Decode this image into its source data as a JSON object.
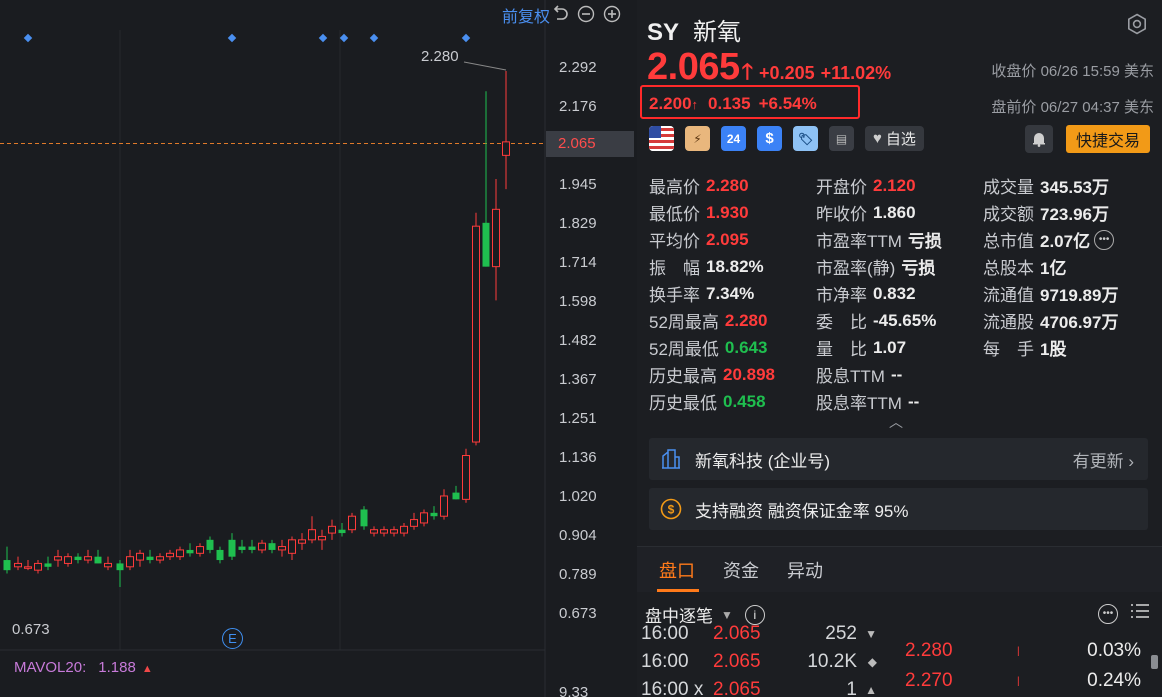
{
  "chart": {
    "toolbar_label": "前复权",
    "y_ticks": [
      "2.292",
      "2.176",
      "1.945",
      "1.829",
      "1.714",
      "1.598",
      "1.482",
      "1.367",
      "1.251",
      "1.136",
      "1.020",
      "0.904",
      "0.789",
      "0.673"
    ],
    "current_price_tag": "2.065",
    "high_label": "2.280",
    "low_label": "0.673",
    "bottom_tick": "9.33",
    "event_marker": "E",
    "mavol_label": "MAVOL20:",
    "mavol_value": "1.188",
    "colors": {
      "up": "#ff3b3b",
      "down": "#1fbf4f",
      "accent": "#4a8ff0"
    }
  },
  "quote": {
    "ticker": "SY",
    "name": "新氧",
    "price": "2.065",
    "change": "+0.205",
    "change_pct": "+11.02%",
    "close_meta": "收盘价 06/26 15:59 美东",
    "pre_price": "2.200",
    "pre_change": "0.135",
    "pre_change_pct": "+6.54%",
    "pre_meta": "盘前价 06/27 04:37 美东",
    "watch_label": "自选",
    "trade_label": "快捷交易",
    "badge_24": "24"
  },
  "stats": [
    [
      {
        "label": "最高价",
        "value": "2.280",
        "color": "red"
      },
      {
        "label": "开盘价",
        "value": "2.120",
        "color": "red"
      },
      {
        "label": "成交量",
        "value": "345.53万",
        "color": "white"
      }
    ],
    [
      {
        "label": "最低价",
        "value": "1.930",
        "color": "red"
      },
      {
        "label": "昨收价",
        "value": "1.860",
        "color": "white"
      },
      {
        "label": "成交额",
        "value": "723.96万",
        "color": "white"
      }
    ],
    [
      {
        "label": "平均价",
        "value": "2.095",
        "color": "red"
      },
      {
        "label": "市盈率TTM",
        "value": "亏损",
        "color": "white"
      },
      {
        "label": "总市值",
        "value": "2.07亿",
        "color": "white"
      }
    ],
    [
      {
        "label": "振　幅",
        "value": "18.82%",
        "color": "white"
      },
      {
        "label": "市盈率(静)",
        "value": "亏损",
        "color": "white"
      },
      {
        "label": "总股本",
        "value": "1亿",
        "color": "white"
      }
    ],
    [
      {
        "label": "换手率",
        "value": "7.34%",
        "color": "white"
      },
      {
        "label": "市净率",
        "value": "0.832",
        "color": "white"
      },
      {
        "label": "流通值",
        "value": "9719.89万",
        "color": "white"
      }
    ],
    [
      {
        "label": "52周最高",
        "value": "2.280",
        "color": "red"
      },
      {
        "label": "委　比",
        "value": "-45.65%",
        "color": "white"
      },
      {
        "label": "流通股",
        "value": "4706.97万",
        "color": "white"
      }
    ],
    [
      {
        "label": "52周最低",
        "value": "0.643",
        "color": "green"
      },
      {
        "label": "量　比",
        "value": "1.07",
        "color": "white"
      },
      {
        "label": "每　手",
        "value": "1股",
        "color": "white"
      }
    ],
    [
      {
        "label": "历史最高",
        "value": "20.898",
        "color": "red"
      },
      {
        "label": "股息TTM",
        "value": "--",
        "color": "white"
      },
      null
    ],
    [
      {
        "label": "历史最低",
        "value": "0.458",
        "color": "green"
      },
      {
        "label": "股息率TTM",
        "value": "--",
        "color": "white"
      },
      null
    ]
  ],
  "cards": {
    "company": "新氧科技 (企业号)",
    "company_right": "有更新",
    "margin": "支持融资 融资保证金率 95%"
  },
  "tabs": [
    "盘口",
    "资金",
    "异动"
  ],
  "ticks_title": "盘中逐笔",
  "ticks": [
    {
      "time": "16:00",
      "price": "2.065",
      "vol": "252",
      "dir": "▼"
    },
    {
      "time": "16:00",
      "price": "2.065",
      "vol": "10.2K",
      "dir": "◆"
    },
    {
      "time": "16:00 x",
      "price": "2.065",
      "vol": "1",
      "dir": "▲"
    }
  ],
  "book": [
    {
      "price": "2.280",
      "pct": "0.03%"
    },
    {
      "price": "2.270",
      "pct": "0.24%"
    }
  ]
}
